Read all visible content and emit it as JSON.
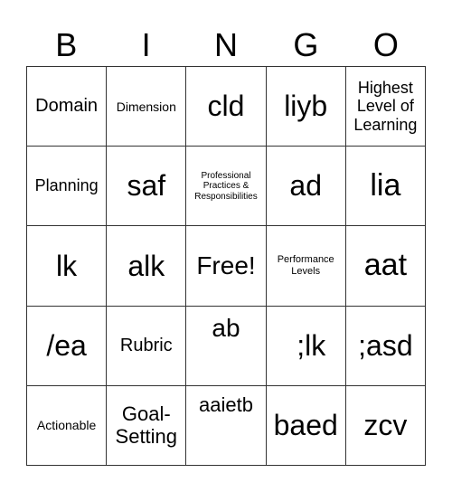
{
  "header": [
    "B",
    "I",
    "N",
    "G",
    "O"
  ],
  "cells": [
    "Domain",
    "Dimension",
    "cld",
    "liyb",
    "Highest Level of Learning",
    "Planning",
    "saf",
    "Professional Practices & Responsibilities",
    "ad",
    "lia",
    "lk",
    "alk",
    "Free!",
    "Performance Levels",
    "aat",
    "/ea",
    "Rubric",
    "ab",
    ";lk",
    ";asd",
    "Actionable",
    "Goal-Setting",
    "aaietb",
    "baed",
    "zcv"
  ]
}
